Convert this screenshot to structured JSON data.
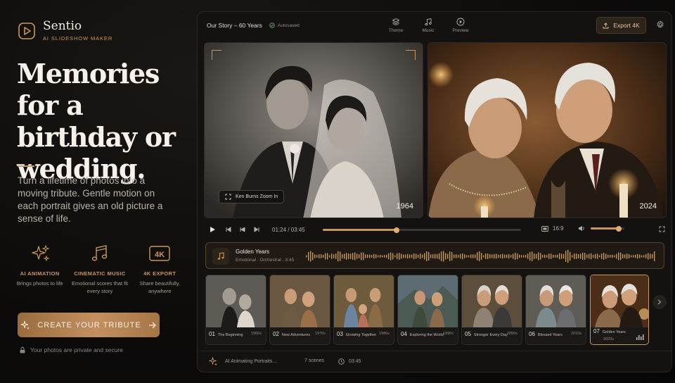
{
  "brand": {
    "name": "Sentio",
    "tagline": "AI SLIDESHOW MAKER",
    "accent": "#c9975a"
  },
  "hero": {
    "headline": "Memories for a birthday or wedding.",
    "blurb": "Turn a lifetime of photos into a moving tribute. Gentle motion on each portrait gives an old picture a sense of life."
  },
  "features": [
    {
      "icon": "sparkles-icon",
      "title": "AI ANIMATION",
      "desc": "Brings photos to life"
    },
    {
      "icon": "music-notes-icon",
      "title": "CINEMATIC MUSIC",
      "desc": "Emotional scores that fit every story"
    },
    {
      "icon": "4k-icon",
      "badge": "4K",
      "title": "4K EXPORT",
      "desc": "Share beautifully, anywhere"
    }
  ],
  "cta": {
    "label": "CREATE YOUR TRIBUTE",
    "privacy": "Your photos are private and secure"
  },
  "app": {
    "project_title": "Our Story – 60 Years",
    "autosave": "Autosaved",
    "tabs": [
      {
        "label": "Theme",
        "icon": "layers-icon"
      },
      {
        "label": "Music",
        "icon": "music-icon"
      },
      {
        "label": "Preview",
        "icon": "play-circle-icon"
      }
    ],
    "export_label": "Export 4K",
    "photos": [
      {
        "year": "1964",
        "chip": "Ken Burns Zoom In"
      },
      {
        "year": "2024"
      }
    ],
    "player": {
      "current": "01:24",
      "total": "03:45",
      "progress": 0.373,
      "ratio": "16:9",
      "volume": 0.83
    },
    "audio": {
      "title": "Golden Years",
      "meta": "Emotional · Orchestral · 3:45"
    },
    "clips": [
      {
        "num": "01",
        "name": "The Beginning",
        "decade": "1960s"
      },
      {
        "num": "02",
        "name": "New Adventures",
        "decade": "1970s"
      },
      {
        "num": "03",
        "name": "Growing Together",
        "decade": "1980s"
      },
      {
        "num": "04",
        "name": "Exploring the World",
        "decade": "1990s"
      },
      {
        "num": "05",
        "name": "Stronger Every Day",
        "decade": "2000s"
      },
      {
        "num": "06",
        "name": "Blessed Years",
        "decade": "2010s"
      },
      {
        "num": "07",
        "name": "Golden Years",
        "decade": "2020s",
        "active": true
      }
    ],
    "status": {
      "animating": "AI Animating Portraits...",
      "scenes": "7 scenes",
      "duration": "03:45"
    }
  }
}
